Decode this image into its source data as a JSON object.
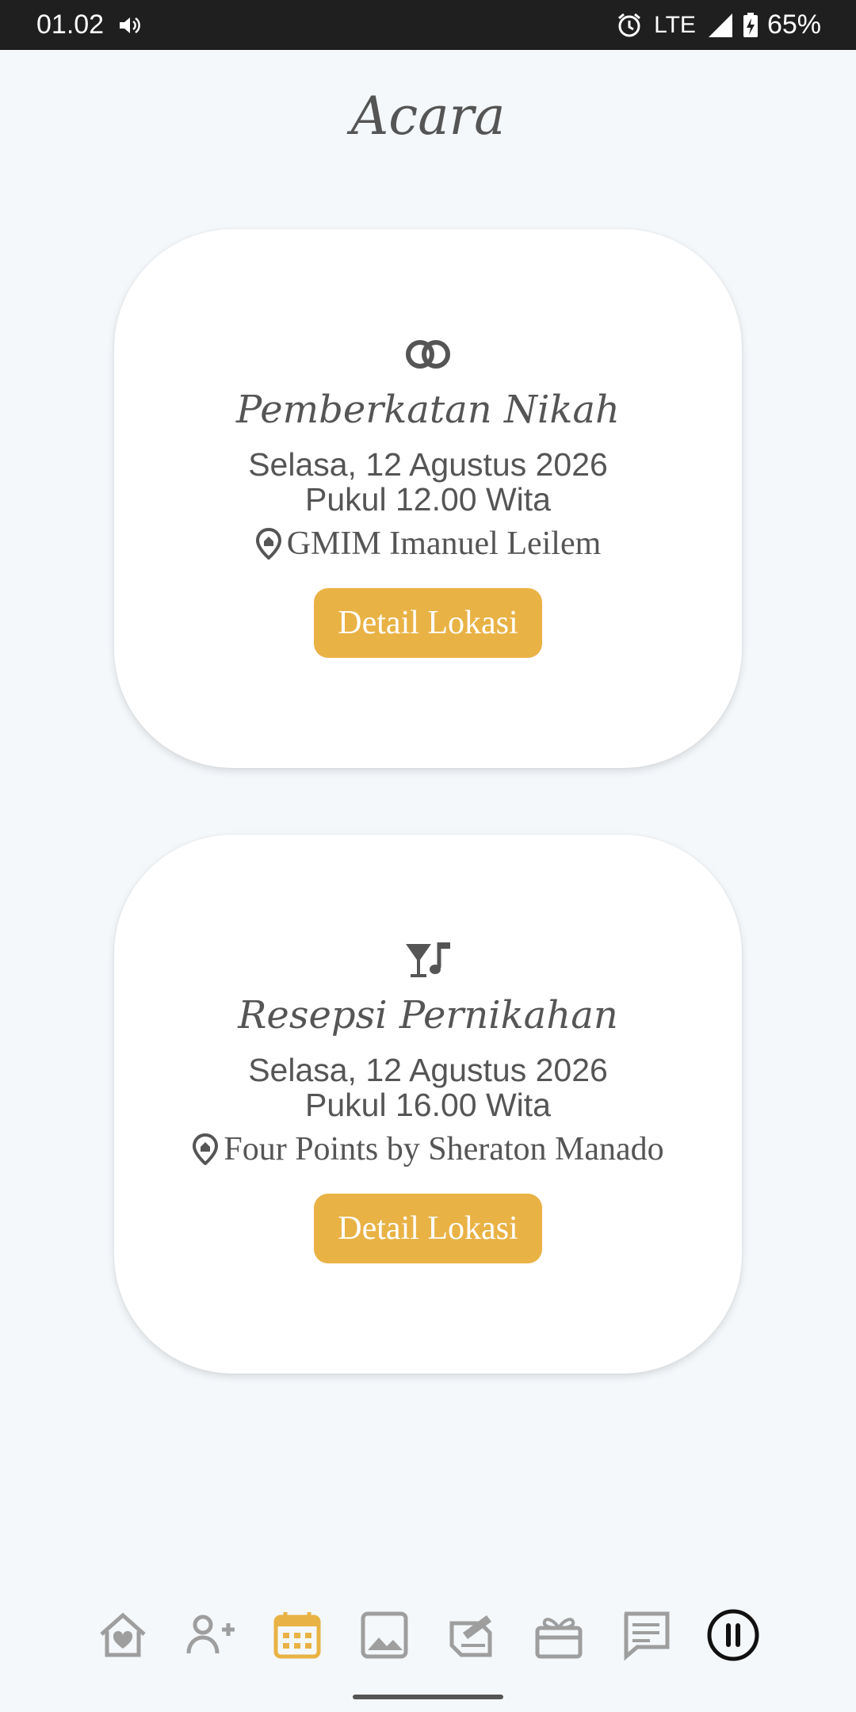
{
  "status_bar": {
    "time": "01.02",
    "network": "LTE",
    "battery": "65%"
  },
  "page": {
    "title": "Acara"
  },
  "events": [
    {
      "icon": "rings-icon",
      "title": "Pemberkatan Nikah",
      "date": "Selasa, 12 Agustus 2026",
      "time": "Pukul 12.00 Wita",
      "location": "GMIM Imanuel Leilem",
      "button_label": "Detail Lokasi"
    },
    {
      "icon": "cocktail-music-icon",
      "title": "Resepsi Pernikahan",
      "date": "Selasa, 12 Agustus 2026",
      "time": "Pukul 16.00 Wita",
      "location": "Four Points by Sheraton Manado",
      "button_label": "Detail Lokasi"
    }
  ],
  "bottom_nav": {
    "items": [
      "home-heart-icon",
      "user-add-icon",
      "calendar-icon",
      "image-icon",
      "book-write-icon",
      "gift-icon",
      "chat-icon",
      "pause-icon"
    ],
    "active": "calendar-icon"
  },
  "colors": {
    "accent": "#e9b245",
    "text": "#555555",
    "background": "#f4f8fb",
    "nav_icon": "#9e9e9e"
  }
}
